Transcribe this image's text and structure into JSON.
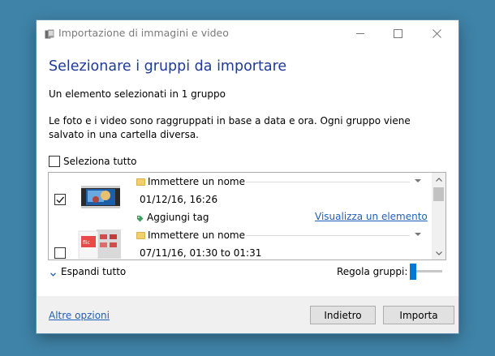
{
  "window": {
    "title": "Importazione di immagini e video"
  },
  "main": {
    "heading": "Selezionare i gruppi da importare",
    "subtitle": "Un elemento selezionati in 1 gruppo",
    "description": "Le foto e i video sono raggruppati in base a data e ora. Ogni gruppo viene salvato in una cartella diversa.",
    "select_all": {
      "label": "Seleziona tutto",
      "checked": false
    }
  },
  "groups": [
    {
      "checked": true,
      "name_placeholder": "Immettere un nome",
      "date": "01/12/16, 16:26",
      "tag_label": "Aggiungi tag",
      "view_link": "Visualizza un elemento"
    },
    {
      "checked": false,
      "name_placeholder": "Immettere un nome",
      "date": "07/11/16, 01:30 to 01:31"
    }
  ],
  "controls": {
    "expand_all": "Espandi tutto",
    "adjust_groups": "Regola gruppi:",
    "adjust_groups_level": 0
  },
  "footer": {
    "more_options": "Altre opzioni",
    "back_label": "Indietro",
    "import_label": "Importa"
  },
  "icons": {
    "app": "photos-import-icon",
    "minimize": "minimize-icon",
    "maximize": "maximize-icon",
    "close": "close-icon",
    "folder": "folder-icon",
    "tag": "tag-icon",
    "chevron": "chevron-down-icon",
    "checkmark": "checkmark-icon"
  },
  "colors": {
    "background": "#3f83a8",
    "heading": "#1e3b99",
    "link": "#1f5fb8",
    "accent": "#0078d7",
    "footer": "#f0f0f0"
  }
}
